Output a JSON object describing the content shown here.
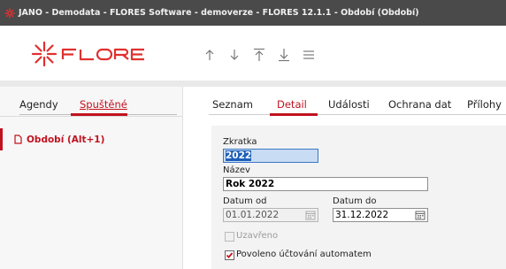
{
  "window": {
    "title": "JANO - Demodata - FLORES Software - demoverze - FLORES 12.1.1 - Období  (Období)"
  },
  "brand": {
    "logo_text": "FLORES",
    "accent": "#c1121f"
  },
  "toolbar": {
    "buttons": [
      {
        "name": "arrow-up-icon"
      },
      {
        "name": "arrow-down-icon"
      },
      {
        "name": "move-to-top-icon"
      },
      {
        "name": "move-to-bottom-icon"
      },
      {
        "name": "menu-icon"
      }
    ]
  },
  "left_panel": {
    "tabs": [
      {
        "label": "Agendy",
        "active": false
      },
      {
        "label": "Spuštěné",
        "active": true
      }
    ],
    "items": [
      {
        "label": "Období (Alt+1)",
        "icon": "document-icon"
      }
    ]
  },
  "right_panel": {
    "tabs": [
      {
        "label": "Seznam",
        "active": false
      },
      {
        "label": "Detail",
        "active": true
      },
      {
        "label": "Události",
        "active": false
      },
      {
        "label": "Ochrana dat",
        "active": false
      },
      {
        "label": "Přílohy",
        "active": false
      }
    ]
  },
  "form": {
    "zkratka": {
      "label": "Zkratka",
      "value": "2022"
    },
    "nazev": {
      "label": "Název",
      "value": "Rok 2022"
    },
    "datum_od": {
      "label": "Datum od",
      "value": "01.01.2022",
      "disabled": true
    },
    "datum_do": {
      "label": "Datum do",
      "value": "31.12.2022",
      "disabled": false
    },
    "uzavreno": {
      "label": "Uzavřeno",
      "checked": false,
      "disabled": true
    },
    "povoleno": {
      "label": "Povoleno účtování automatem",
      "checked": true,
      "disabled": false
    }
  }
}
